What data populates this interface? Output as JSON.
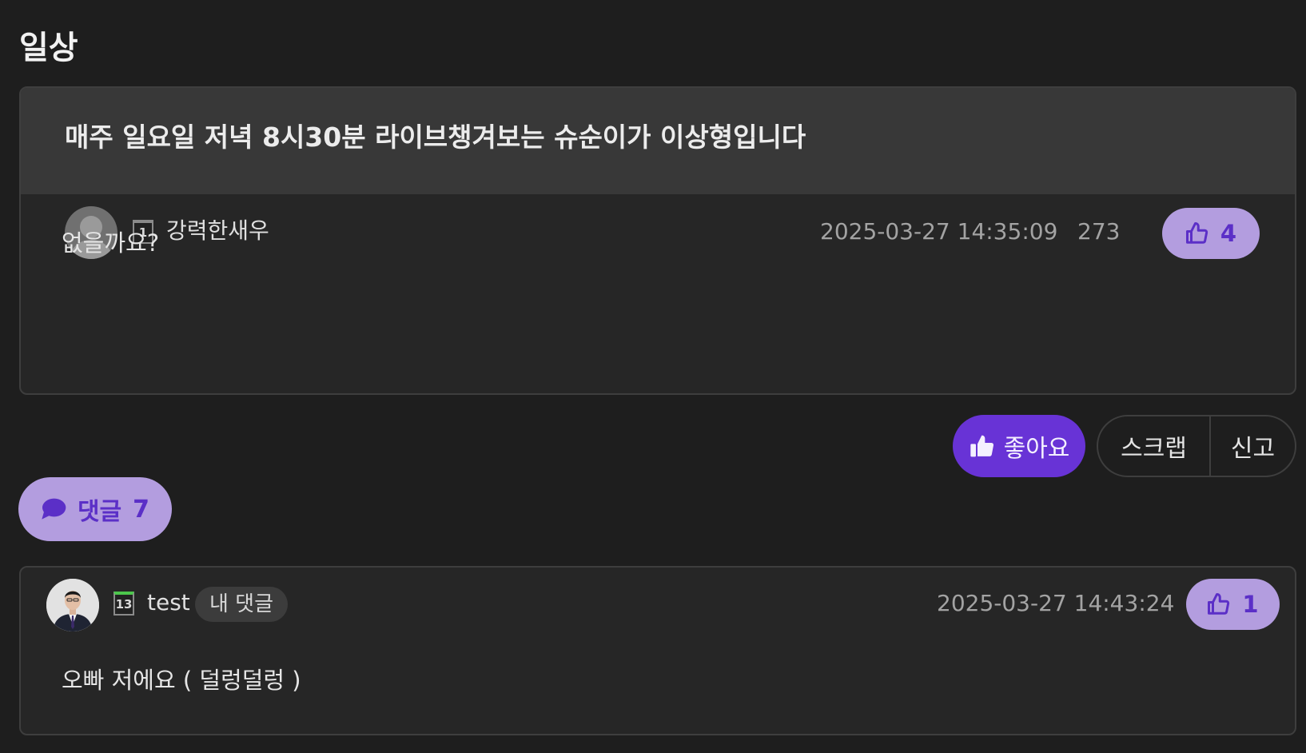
{
  "board": {
    "title": "일상"
  },
  "post": {
    "title": "매주 일요일 저녁 8시30분 라이브챙겨보는 슈순이가 이상형입니다",
    "author": {
      "name": "강력한새우",
      "level": "1",
      "avatar_icon": "default-user-icon"
    },
    "datetime": "2025-03-27 14:35:09",
    "views": "273",
    "like_count": "4",
    "body": "없을까요?"
  },
  "actions": {
    "like_label": "좋아요",
    "scrap_label": "스크랩",
    "report_label": "신고"
  },
  "comments": {
    "toggle_label": "댓글",
    "count": "7",
    "items": [
      {
        "author": "test",
        "level": "13",
        "badge": "내 댓글",
        "datetime": "2025-03-27 14:43:24",
        "like_count": "1",
        "text": "오빠 저에요 ( 덜렁덜렁 )"
      }
    ]
  },
  "colors": {
    "background": "#1e1e1e",
    "card": "#262626",
    "card_header": "#383838",
    "accent": "#6833d6",
    "accent_soft": "#b39ddf",
    "accent_text": "#5b2fc7"
  }
}
